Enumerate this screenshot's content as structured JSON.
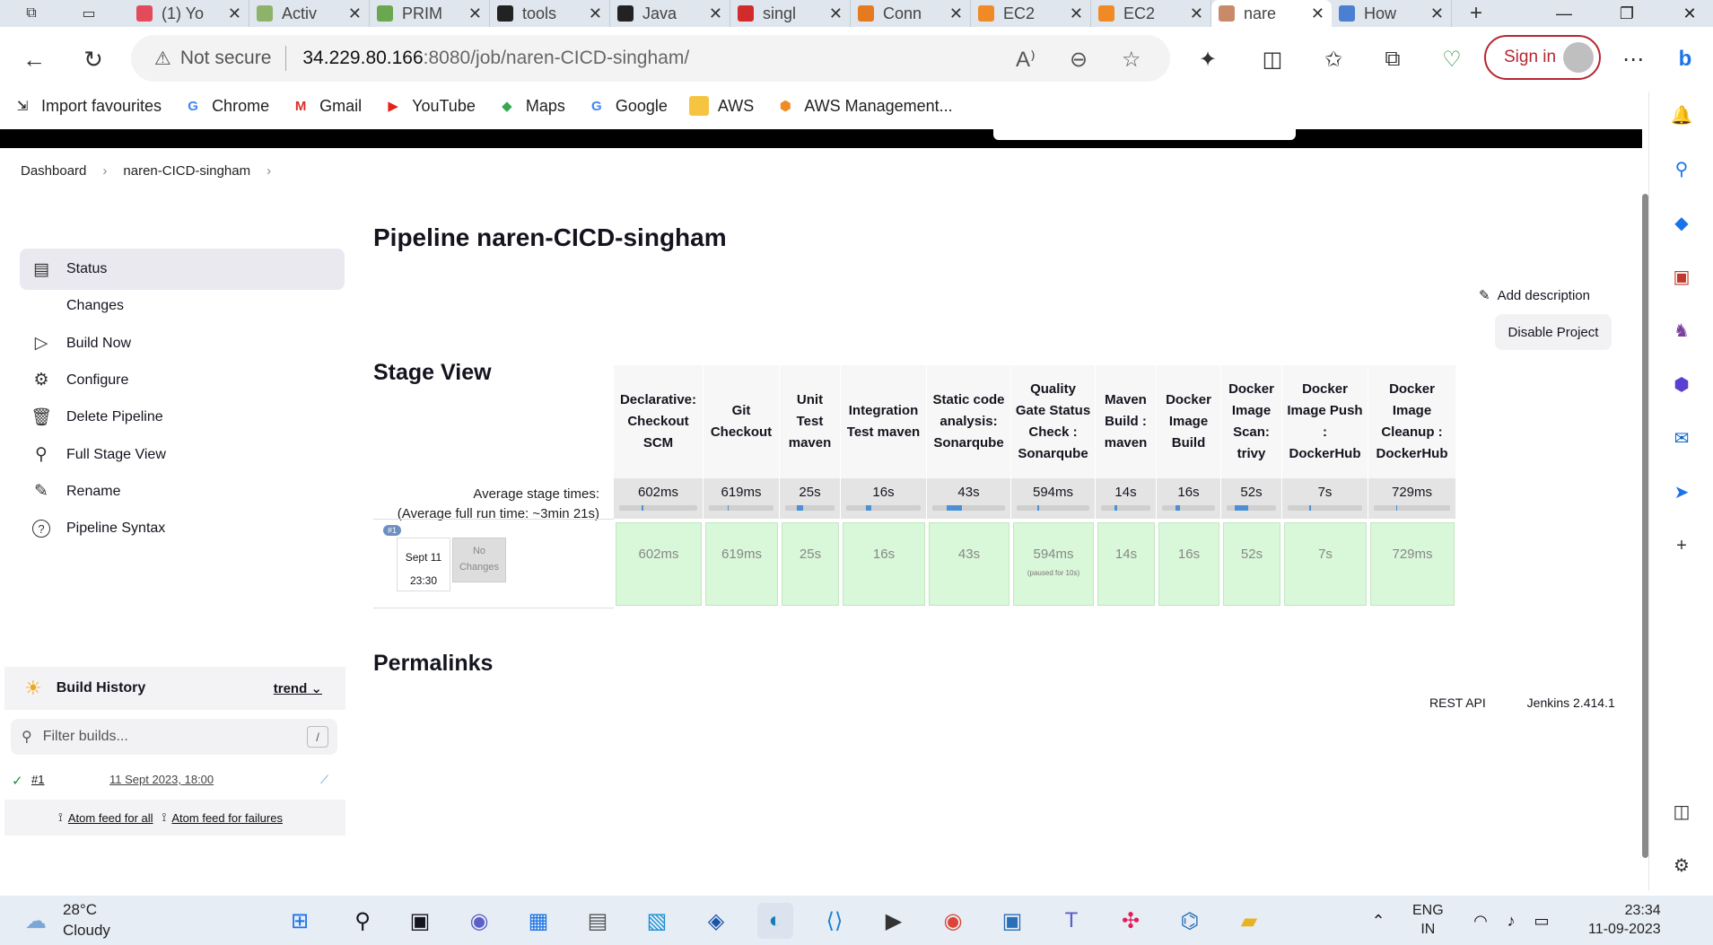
{
  "browser": {
    "tabs": [
      {
        "title": "(1) Yo",
        "favicon_color": "#e24b5b",
        "favicon_icon": "youtube-icon"
      },
      {
        "title": "Activ",
        "favicon_color": "#8db36a",
        "favicon_icon": "jenkins-icon"
      },
      {
        "title": "PRIM",
        "favicon_color": "#6aa84f",
        "favicon_icon": "jenkins-icon"
      },
      {
        "title": "tools",
        "favicon_color": "#222222",
        "favicon_icon": "github-icon"
      },
      {
        "title": "Java",
        "favicon_color": "#222222",
        "favicon_icon": "github-icon"
      },
      {
        "title": "singl",
        "favicon_color": "#d12b2b",
        "favicon_icon": "pdf-icon"
      },
      {
        "title": "Conn",
        "favicon_color": "#e67a21",
        "favicon_icon": "aws-icon"
      },
      {
        "title": "EC2",
        "favicon_color": "#f08a24",
        "favicon_icon": "ec2-icon"
      },
      {
        "title": "EC2",
        "favicon_color": "#f08a24",
        "favicon_icon": "ec2-icon"
      },
      {
        "title": "nare",
        "favicon_color": "#c98a6a",
        "favicon_icon": "jenkins-icon"
      },
      {
        "title": "How",
        "favicon_color": "#4a7fd1",
        "favicon_icon": "blog-icon"
      }
    ],
    "url": {
      "warning": "Not secure",
      "host": "34.229.80.166",
      "path": ":8080/job/naren-CICD-singham/"
    },
    "signin_label": "Sign in"
  },
  "bookmarks": [
    {
      "label": "Import favourites",
      "icon": "import-icon",
      "color": "#333333"
    },
    {
      "label": "Chrome",
      "icon": "google-icon",
      "color": "#4285f4"
    },
    {
      "label": "Gmail",
      "icon": "gmail-icon",
      "color": "#d93025"
    },
    {
      "label": "YouTube",
      "icon": "youtube-icon",
      "color": "#e62117"
    },
    {
      "label": "Maps",
      "icon": "maps-icon",
      "color": "#34a853"
    },
    {
      "label": "Google",
      "icon": "google-icon",
      "color": "#4285f4"
    },
    {
      "label": "AWS",
      "icon": "folder-icon",
      "color": "#f5c542"
    },
    {
      "label": "AWS Management...",
      "icon": "aws-icon",
      "color": "#f08a24"
    }
  ],
  "breadcrumb": [
    "Dashboard",
    "naren-CICD-singham"
  ],
  "sidebar": {
    "items": [
      {
        "label": "Status",
        "icon": "clipboard-icon"
      },
      {
        "label": "Changes",
        "icon": "code-icon"
      },
      {
        "label": "Build Now",
        "icon": "play-icon"
      },
      {
        "label": "Configure",
        "icon": "gear-icon"
      },
      {
        "label": "Delete Pipeline",
        "icon": "trash-icon"
      },
      {
        "label": "Full Stage View",
        "icon": "search-icon"
      },
      {
        "label": "Rename",
        "icon": "pencil-icon"
      },
      {
        "label": "Pipeline Syntax",
        "icon": "help-icon"
      }
    ],
    "build_history": {
      "title": "Build History",
      "trend": "trend",
      "filter_placeholder": "Filter builds...",
      "filter_shortcut": "/",
      "builds": [
        {
          "number": "#1",
          "date": "11 Sept 2023, 18:00"
        }
      ],
      "feed_all": "Atom feed for all",
      "feed_failures": "Atom feed for failures"
    }
  },
  "main": {
    "title": "Pipeline naren-CICD-singham",
    "add_description": "Add description",
    "disable_project": "Disable Project",
    "stage_view_title": "Stage View",
    "permalinks_title": "Permalinks",
    "avg_stage_label": "Average stage times:",
    "avg_run_prefix": "(Average ",
    "avg_run_link": "full",
    "avg_run_suffix": " run time: ~3min 21s)",
    "build": {
      "badge": "#1",
      "date": "Sept 11",
      "time": "23:30",
      "changes": "No Changes"
    }
  },
  "stages": [
    {
      "name": "Declarative: Checkout SCM",
      "avg": "602ms",
      "run": "602ms",
      "bar": 0.0
    },
    {
      "name": "Git Checkout",
      "avg": "619ms",
      "run": "619ms",
      "bar": 0.0
    },
    {
      "name": "Unit Test maven",
      "avg": "25s",
      "run": "25s",
      "bar": 0.12
    },
    {
      "name": "Integration Test maven",
      "avg": "16s",
      "run": "16s",
      "bar": 0.08
    },
    {
      "name": "Static code analysis: Sonarqube",
      "avg": "43s",
      "run": "43s",
      "bar": 0.21
    },
    {
      "name": "Quality Gate Status Check : Sonarqube",
      "avg": "594ms",
      "run": "594ms",
      "note": "(paused for 10s)",
      "bar": 0.0
    },
    {
      "name": "Maven Build : maven",
      "avg": "14s",
      "run": "14s",
      "bar": 0.07
    },
    {
      "name": "Docker Image Build",
      "avg": "16s",
      "run": "16s",
      "bar": 0.08
    },
    {
      "name": "Docker Image Scan: trivy",
      "avg": "52s",
      "run": "52s",
      "bar": 0.26
    },
    {
      "name": "Docker Image Push : DockerHub",
      "avg": "7s",
      "run": "7s",
      "bar": 0.03
    },
    {
      "name": "Docker Image Cleanup : DockerHub",
      "avg": "729ms",
      "run": "729ms",
      "bar": 0.0
    }
  ],
  "footer": {
    "rest_api": "REST API",
    "version": "Jenkins 2.414.1"
  },
  "taskbar": {
    "weather_temp": "28°C",
    "weather_desc": "Cloudy",
    "lang_top": "ENG",
    "lang_bottom": "IN",
    "time": "23:34",
    "date": "11-09-2023"
  }
}
